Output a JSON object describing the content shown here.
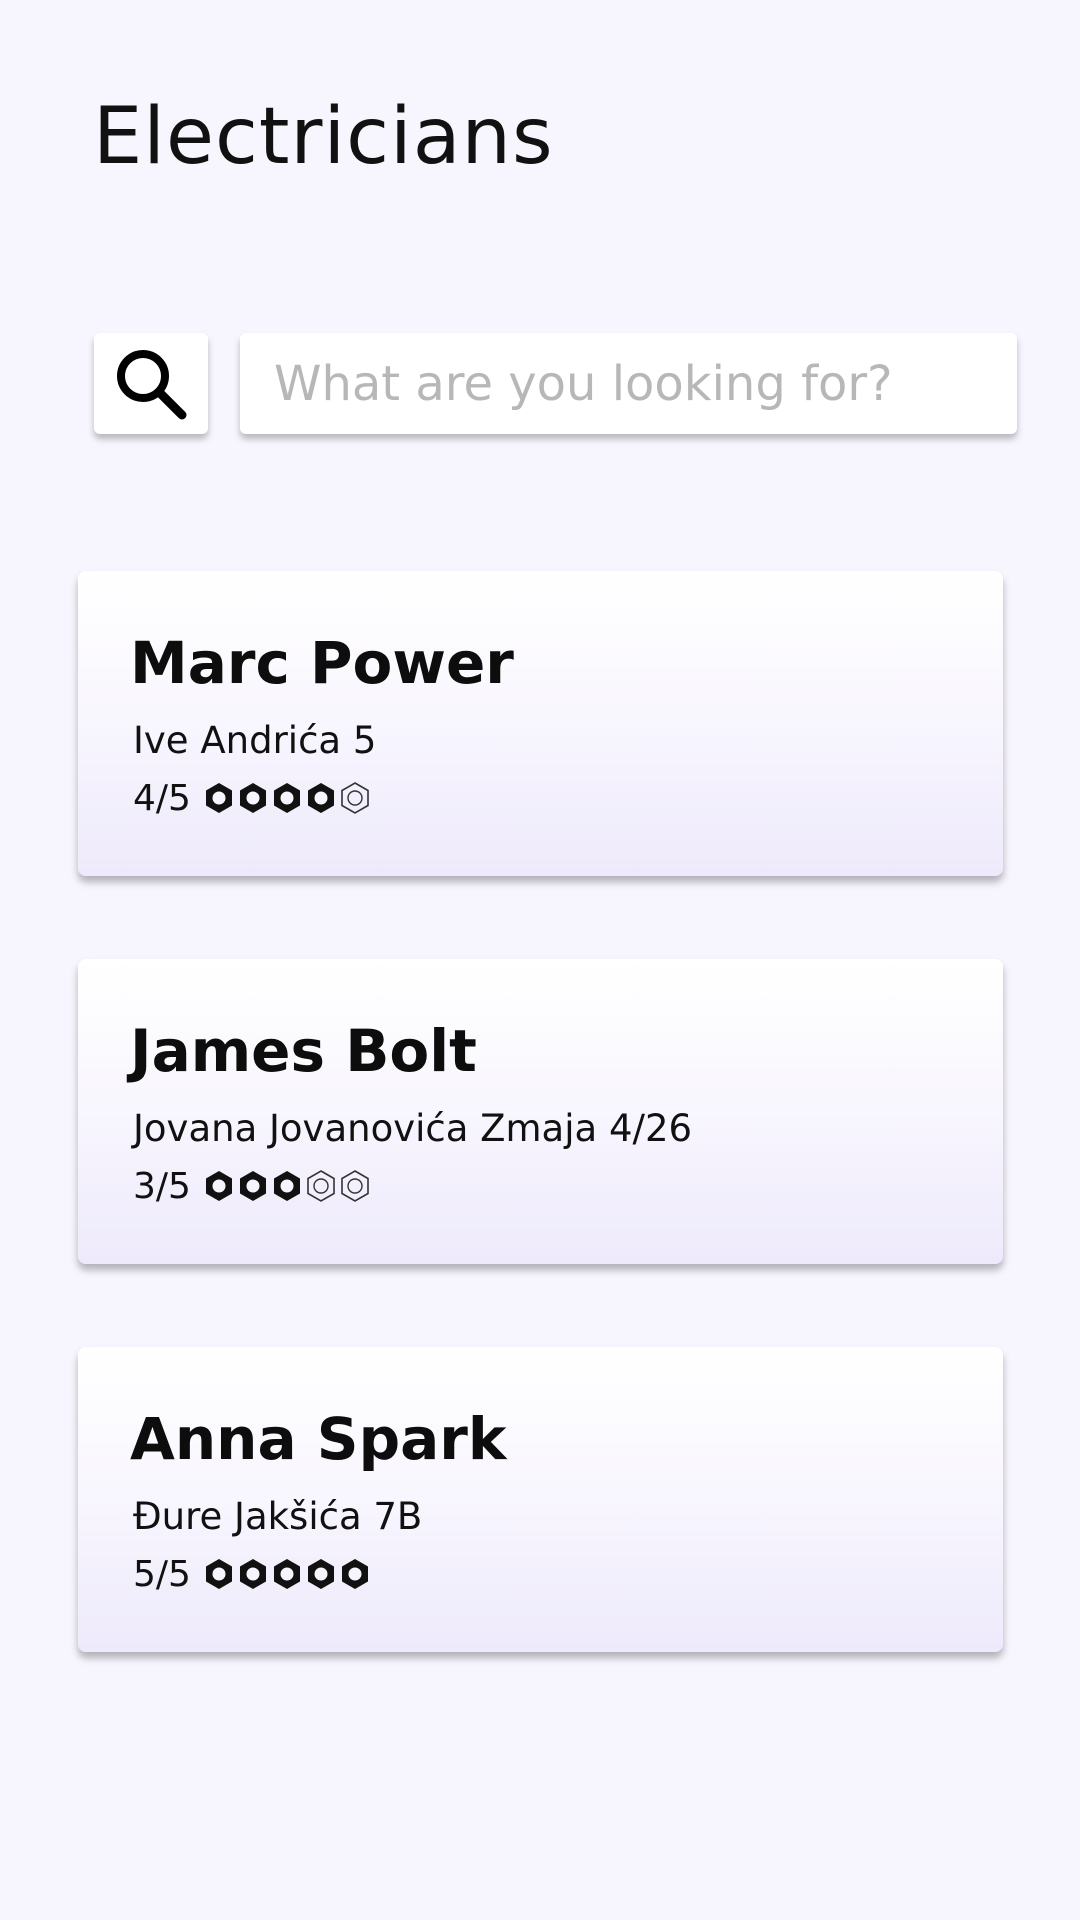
{
  "header": {
    "title": "Electricians"
  },
  "search": {
    "placeholder": "What are you looking for?",
    "icon": "search-icon"
  },
  "listings": [
    {
      "name": "Marc Power",
      "address": "Ive Andrića 5",
      "rating_text": "4/5",
      "rating": 4,
      "max_rating": 5
    },
    {
      "name": "James Bolt",
      "address": "Jovana Jovanovića Zmaja 4/26",
      "rating_text": "3/5",
      "rating": 3,
      "max_rating": 5
    },
    {
      "name": "Anna Spark",
      "address": "Đure Jakšića 7B",
      "rating_text": "5/5",
      "rating": 5,
      "max_rating": 5
    }
  ],
  "colors": {
    "background": "#f7f5fd",
    "card_top": "#ffffff",
    "card_bottom": "#eeeafc",
    "text": "#111111",
    "placeholder": "#b7b7b7"
  }
}
